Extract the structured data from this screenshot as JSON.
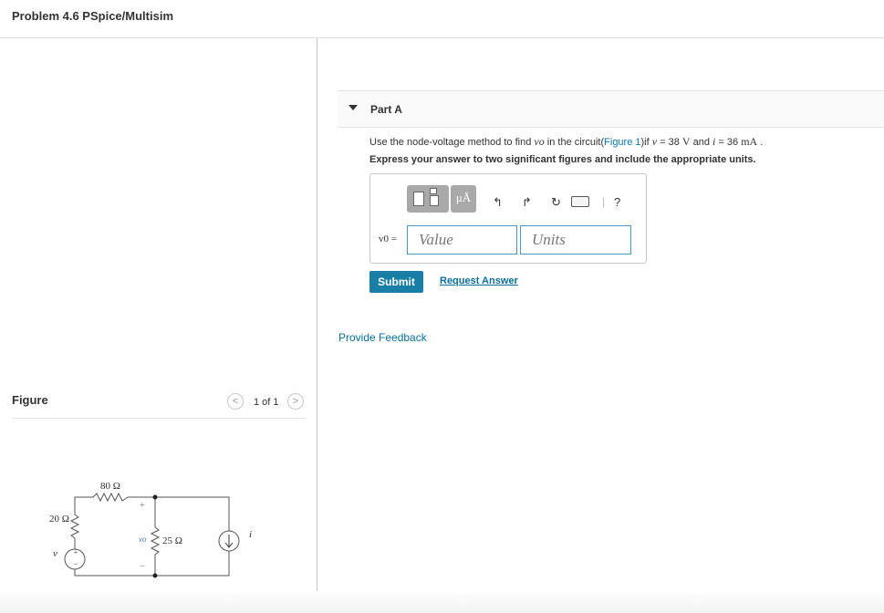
{
  "header": {
    "title": "Problem 4.6 PSpice/Multisim"
  },
  "part": {
    "label": "Part A",
    "question": {
      "prefix": "Use the node-voltage method to find ",
      "var_vo": "vo",
      "mid1": " in the circuit(",
      "figure_link": "Figure 1",
      "mid2": ")if ",
      "var_v": "v",
      "v_eq": " = 38 ",
      "v_unit": "V",
      "and": " and ",
      "var_i": "i",
      "i_eq": " = 36 ",
      "i_unit": "mA",
      "end": " ."
    },
    "instruction": "Express your answer to two significant figures and include the appropriate units.",
    "toolbar": {
      "units_label": "μÅ",
      "undo_icon": "↰",
      "redo_icon": "↱",
      "reset_icon": "↻",
      "separator": "|",
      "help_label": "?"
    },
    "answer": {
      "label": "v0 =",
      "value_placeholder": "Value",
      "units_placeholder": "Units"
    },
    "submit_label": "Submit",
    "request_answer_label": "Request Answer"
  },
  "feedback_label": "Provide Feedback",
  "figure": {
    "label": "Figure",
    "pager": {
      "text": "1 of 1",
      "prev": "<",
      "next": ">"
    },
    "circuit": {
      "r_series": "80 Ω",
      "r_left": "20 Ω",
      "r_mid": "25 Ω",
      "source_v": "v",
      "source_i": "i",
      "vo": "vo",
      "plus": "+",
      "minus": "−"
    }
  }
}
